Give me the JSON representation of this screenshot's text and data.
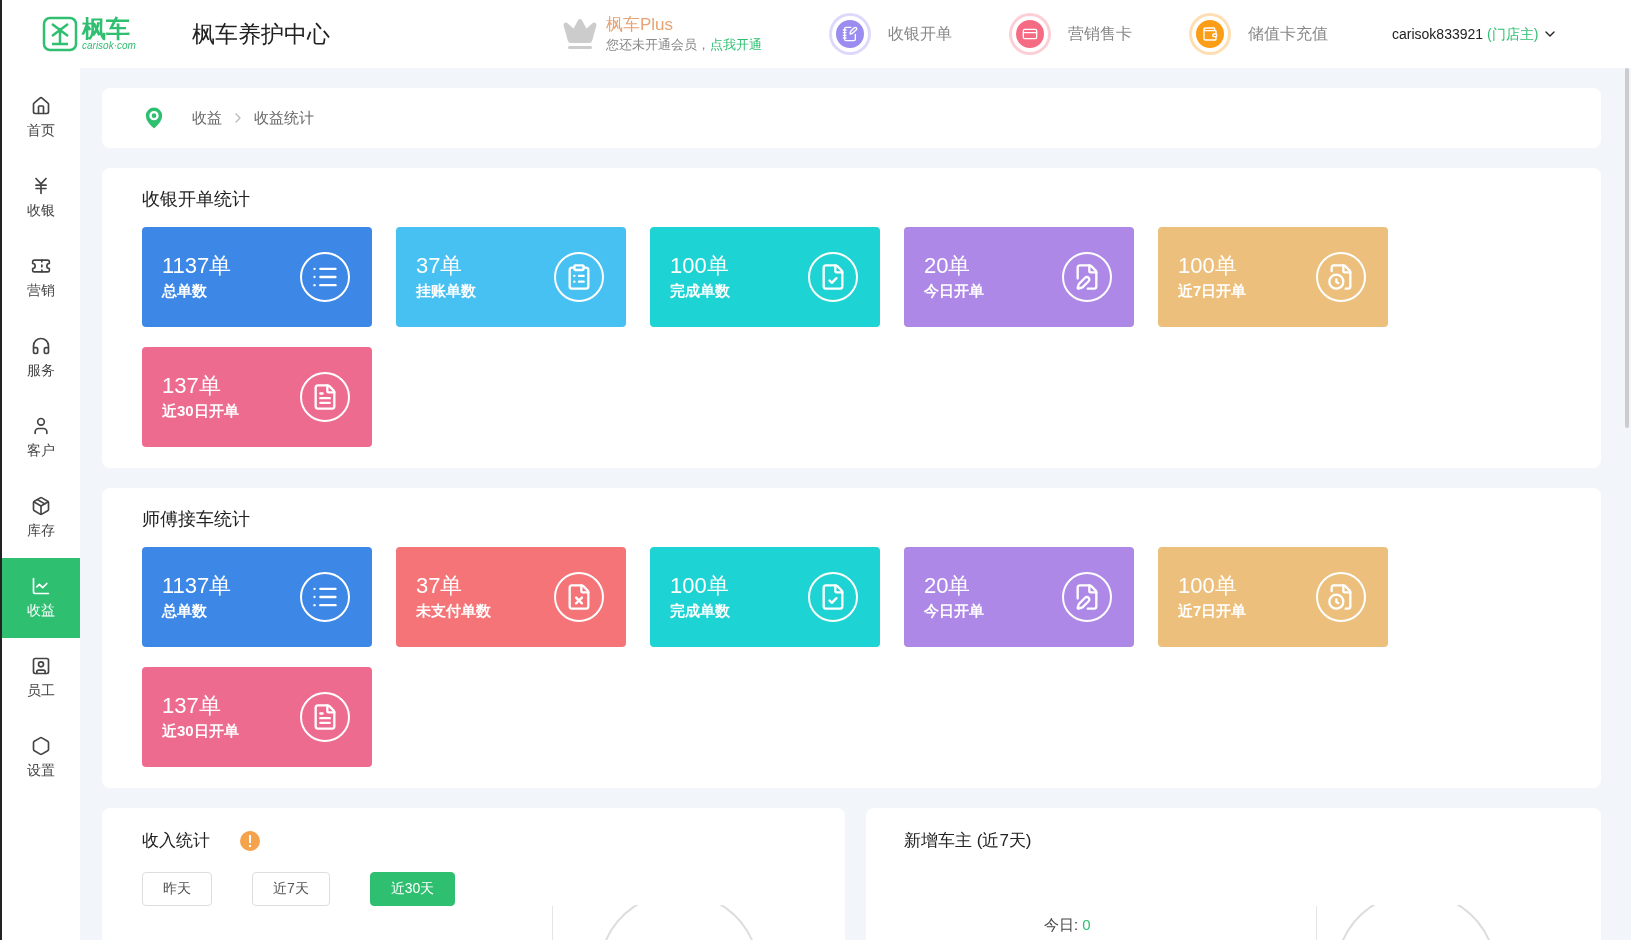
{
  "header": {
    "logo_text": "枫车",
    "logo_sub": "carisok·com",
    "title": "枫车养护中心",
    "plus": {
      "title": "枫车Plus",
      "note": "您还未开通会员，",
      "link": "点我开通"
    },
    "actions": [
      {
        "label": "收银开单",
        "color": "#9b8cf0"
      },
      {
        "label": "营销售卡",
        "color": "#f66b84"
      },
      {
        "label": "储值卡充值",
        "color": "#fc9d17"
      }
    ],
    "user": {
      "name": "carisok833921",
      "role": "(门店主)"
    }
  },
  "sidebar": {
    "items": [
      {
        "label": "首页",
        "selected": false
      },
      {
        "label": "收银",
        "selected": false
      },
      {
        "label": "营销",
        "selected": false
      },
      {
        "label": "服务",
        "selected": false
      },
      {
        "label": "客户",
        "selected": false
      },
      {
        "label": "库存",
        "selected": false
      },
      {
        "label": "收益",
        "selected": true
      },
      {
        "label": "员工",
        "selected": false
      },
      {
        "label": "设置",
        "selected": false
      }
    ]
  },
  "breadcrumb": [
    "收益",
    "收益统计"
  ],
  "sections": [
    {
      "title": "收银开单统计",
      "cards": [
        {
          "value": "1137单",
          "label": "总单数",
          "color": "#3d87e6"
        },
        {
          "value": "37单",
          "label": "挂账单数",
          "color": "#47c1f2"
        },
        {
          "value": "100单",
          "label": "完成单数",
          "color": "#1ed3d3"
        },
        {
          "value": "20单",
          "label": "今日开单",
          "color": "#ae88e6"
        },
        {
          "value": "100单",
          "label": "近7日开单",
          "color": "#ecc07c"
        },
        {
          "value": "137单",
          "label": "近30日开单",
          "color": "#ee6b90"
        }
      ]
    },
    {
      "title": "师傅接车统计",
      "cards": [
        {
          "value": "1137单",
          "label": "总单数",
          "color": "#3d87e6"
        },
        {
          "value": "37单",
          "label": "未支付单数",
          "color": "#f47477"
        },
        {
          "value": "100单",
          "label": "完成单数",
          "color": "#1ed3d3"
        },
        {
          "value": "20单",
          "label": "今日开单",
          "color": "#ae88e6"
        },
        {
          "value": "100单",
          "label": "近7日开单",
          "color": "#ecc07c"
        },
        {
          "value": "137单",
          "label": "近30日开单",
          "color": "#ee6b90"
        }
      ]
    }
  ],
  "income": {
    "title": "收入统计",
    "ranges": [
      {
        "label": "昨天",
        "selected": false
      },
      {
        "label": "近7天",
        "selected": false
      },
      {
        "label": "近30天",
        "selected": true
      }
    ]
  },
  "new_owners": {
    "title": "新增车主 (近7天)",
    "today_label": "今日:",
    "today_value": "0"
  }
}
